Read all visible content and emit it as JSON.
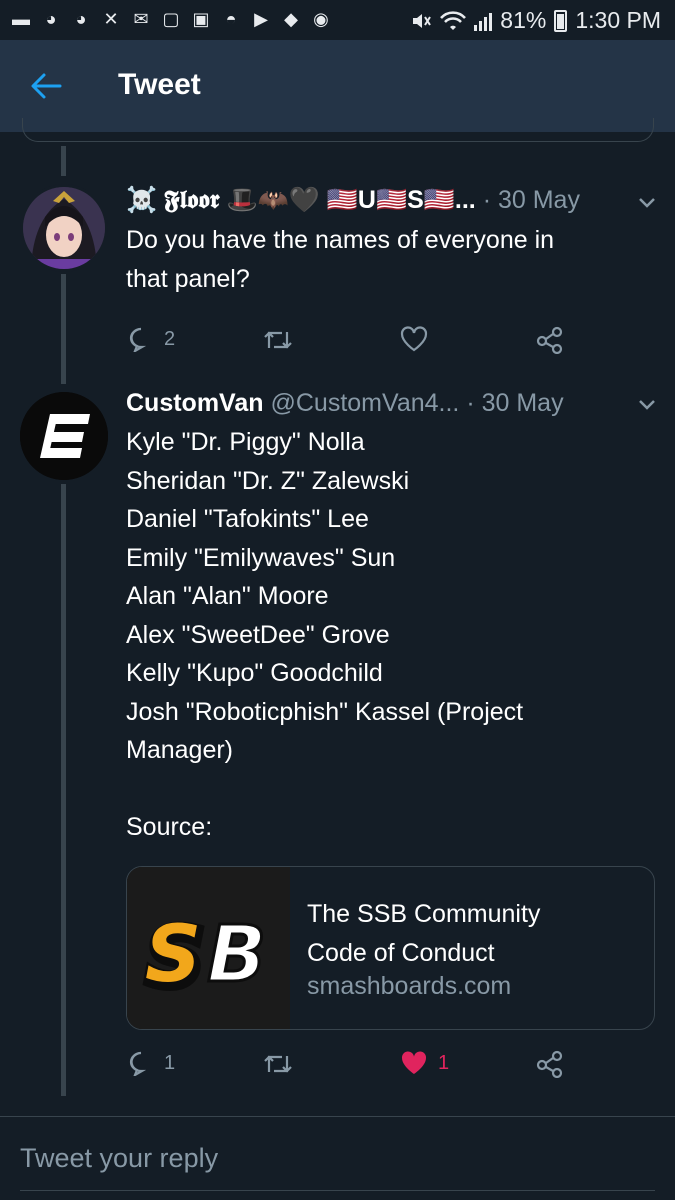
{
  "status_bar": {
    "battery": "81%",
    "time": "1:30 PM",
    "notification_icons": [
      "chat-icon",
      "game-icon",
      "game-icon",
      "tools-icon",
      "mail-icon",
      "chat-icon",
      "image-icon",
      "spy-icon",
      "youtube-icon",
      "shield-icon",
      "messenger-icon"
    ]
  },
  "header": {
    "title": "Tweet"
  },
  "tweets": [
    {
      "display_name": "☠️ 𝕱𝖑𝖔𝖔𝖗 🎩🦇🖤 🇺🇸U🇺🇸S🇺🇸...",
      "handle": "",
      "date": "· 30 May",
      "lines": [
        "Do you have the names of everyone in",
        "that panel?"
      ],
      "replies": "2",
      "retweets": "",
      "likes": ""
    },
    {
      "display_name": "CustomVan",
      "handle": "@CustomVan4...",
      "date": "· 30 May",
      "lines": [
        "Kyle \"Dr. Piggy\" Nolla",
        "Sheridan \"Dr. Z\" Zalewski",
        "Daniel \"Tafokints\" Lee",
        "Emily \"Emilywaves\" Sun",
        "Alan \"Alan\" Moore",
        "Alex \"SweetDee\" Grove",
        "Kelly \"Kupo\" Goodchild",
        "Josh \"Roboticphish\" Kassel (Project",
        "Manager)",
        "",
        "Source:"
      ],
      "card": {
        "logo_text": "SB",
        "title_lines": [
          "The SSB Community",
          "Code of Conduct"
        ],
        "domain": "smashboards.com"
      },
      "replies": "1",
      "retweets": "",
      "likes": "1"
    }
  ],
  "composer": {
    "placeholder": "Tweet your reply"
  },
  "colors": {
    "background": "#141d26",
    "header": "#243447",
    "muted": "#8899a6",
    "accent": "#1da1f2",
    "like": "#e0245e",
    "border": "#38444d"
  }
}
